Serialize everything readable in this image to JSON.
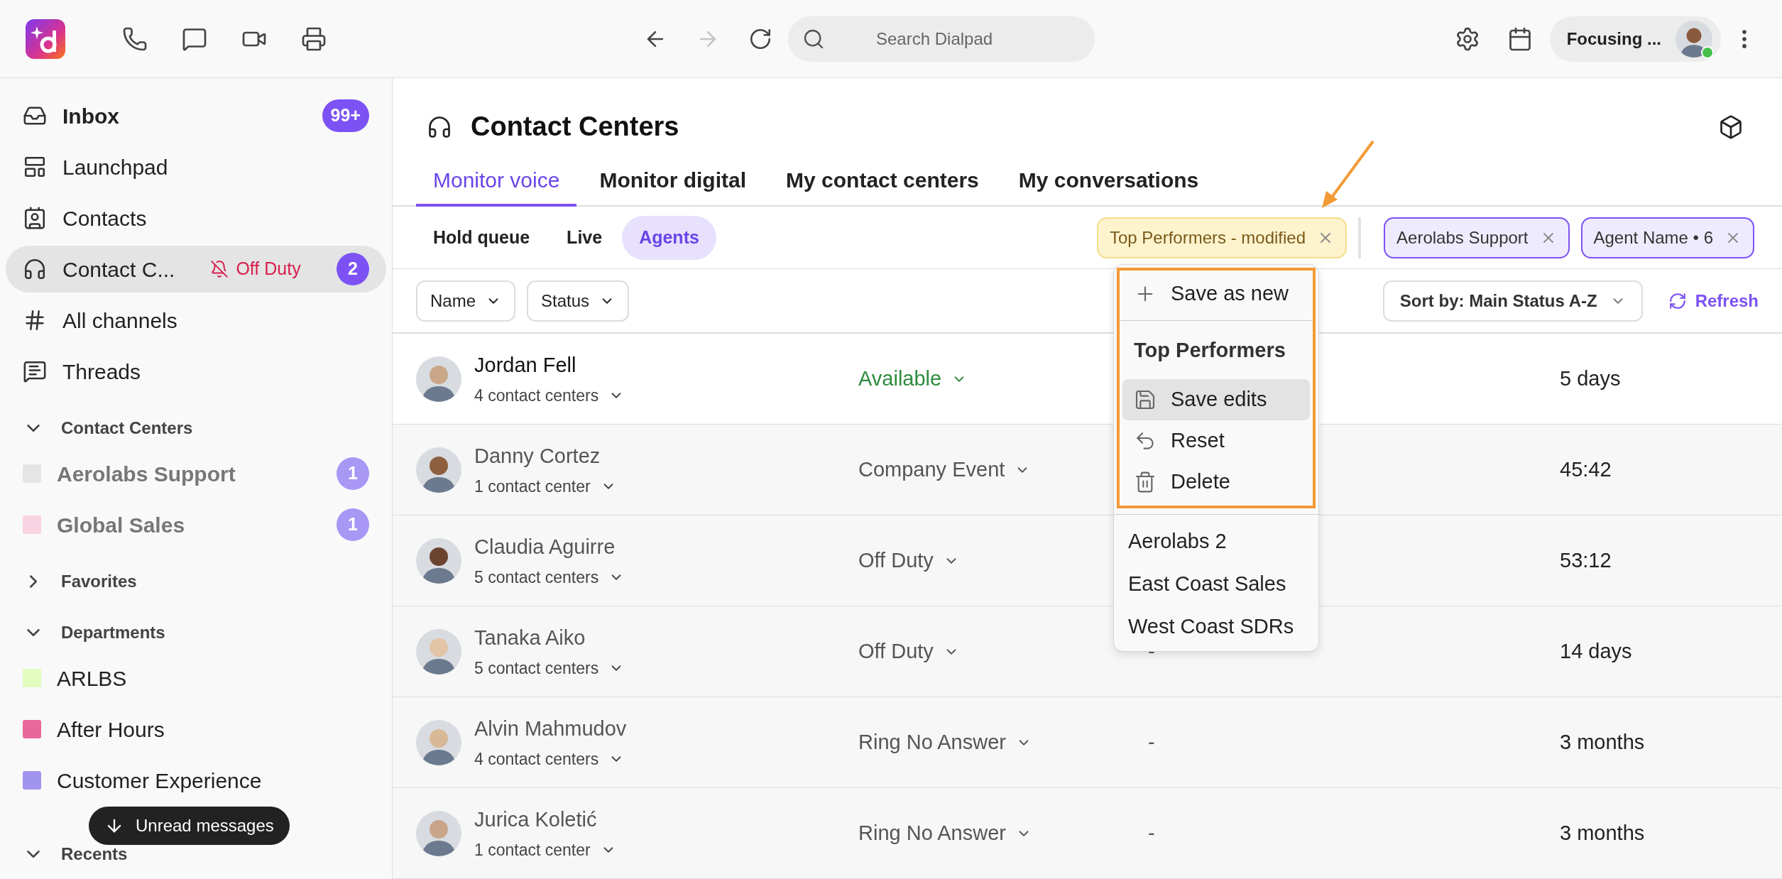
{
  "top_bar": {
    "tools": [
      {
        "kind": "phone"
      },
      {
        "kind": "chat"
      },
      {
        "kind": "video"
      },
      {
        "kind": "print"
      }
    ],
    "nav": [
      {
        "kind": "back",
        "disabled": false
      },
      {
        "kind": "forward",
        "disabled": true
      },
      {
        "kind": "reload",
        "disabled": false
      }
    ],
    "search": {
      "placeholder": "Search Dialpad"
    },
    "status": {
      "label": "Focusing ...",
      "online": true
    }
  },
  "sidebar": {
    "items": [
      {
        "kind": "inbox",
        "label": "Inbox",
        "bold": true,
        "badge": "99+",
        "selected": false
      },
      {
        "kind": "launchpad",
        "label": "Launchpad",
        "bold": false,
        "selected": false
      },
      {
        "kind": "contacts",
        "label": "Contacts",
        "bold": false,
        "selected": false
      },
      {
        "kind": "contact_center",
        "label": "Contact C...",
        "bold": false,
        "status": "Off Duty",
        "badge": "2",
        "selected": true
      },
      {
        "kind": "channels",
        "label": "All channels",
        "bold": false,
        "selected": false
      },
      {
        "kind": "threads",
        "label": "Threads",
        "bold": false,
        "selected": false
      }
    ],
    "sections": [
      {
        "title": "Contact Centers",
        "expanded": true,
        "items": [
          {
            "label": "Aerolabs Support",
            "color": "#e5e5e5",
            "unread": true,
            "badge": "1"
          },
          {
            "label": "Global Sales",
            "color": "#f8d3e2",
            "unread": true,
            "badge": "1"
          }
        ]
      },
      {
        "title": "Favorites",
        "expanded": false
      },
      {
        "title": "Departments",
        "expanded": true,
        "items": [
          {
            "label": "ARLBS",
            "color": "#e3fcc0",
            "unread": false
          },
          {
            "label": "After Hours",
            "color": "#e8689a",
            "unread": false
          },
          {
            "label": "Customer Experience",
            "color": "#a193f0",
            "unread": false
          }
        ]
      },
      {
        "title": "Recents",
        "expanded": true
      }
    ],
    "toast": "Unread messages"
  },
  "page": {
    "title": "Contact Centers",
    "tabs": [
      {
        "label": "Monitor voice",
        "selected": true
      },
      {
        "label": "Monitor digital",
        "selected": false
      },
      {
        "label": "My contact centers",
        "selected": false
      },
      {
        "label": "My conversations",
        "selected": false
      }
    ],
    "subtabs": [
      {
        "label": "Hold queue",
        "selected": false
      },
      {
        "label": "Live",
        "selected": false
      },
      {
        "label": "Agents",
        "selected": true
      }
    ],
    "chips": [
      {
        "label": "Top Performers - modified",
        "kind": "preset"
      },
      {
        "label": "Aerolabs Support",
        "kind": "filter"
      },
      {
        "label": "Agent Name • 6",
        "kind": "filter"
      }
    ],
    "filters": [
      {
        "label": "Name"
      },
      {
        "label": "Status"
      }
    ],
    "sort": "Sort by: Main Status A-Z",
    "refresh": "Refresh"
  },
  "agents": [
    {
      "name": "Jordan Fell",
      "centers": "4 contact centers",
      "active": true,
      "status": {
        "label": "Available",
        "color": "#2e8b3e"
      },
      "column_4": "5 days"
    },
    {
      "name": "Danny Cortez",
      "centers": "1 contact center",
      "active": false,
      "status": {
        "label": "Company Event",
        "color": "#555555"
      },
      "column_4": "45:42"
    },
    {
      "name": "Claudia Aguirre",
      "centers": "5 contact centers",
      "active": false,
      "status": {
        "label": "Off Duty",
        "color": "#555555"
      },
      "column_4": "53:12"
    },
    {
      "name": "Tanaka Aiko",
      "centers": "5 contact centers",
      "active": false,
      "status": {
        "label": "Off Duty",
        "color": "#555555"
      },
      "column_3": "-",
      "column_4": "14 days"
    },
    {
      "name": "Alvin Mahmudov",
      "centers": "4 contact centers",
      "active": false,
      "status": {
        "label": "Ring No Answer",
        "color": "#555555"
      },
      "column_3": "-",
      "column_4": "3 months"
    },
    {
      "name": "Jurica Koletić",
      "centers": "1 contact center",
      "active": false,
      "status": {
        "label": "Ring No Answer",
        "color": "#555555"
      },
      "column_3": "-",
      "column_4": "3 months"
    }
  ],
  "menu": {
    "highlight_frame": true,
    "items": [
      {
        "kind": "new",
        "label": "Save as new",
        "hovered": false
      },
      {
        "kind": "divider"
      },
      {
        "kind": "heading",
        "label": "Top Performers"
      },
      {
        "kind": "save",
        "label": "Save edits",
        "hovered": true
      },
      {
        "kind": "reset",
        "label": "Reset",
        "hovered": false
      },
      {
        "kind": "delete",
        "label": "Delete",
        "hovered": false
      },
      {
        "kind": "divider"
      },
      {
        "kind": "option",
        "label": "Aerolabs 2",
        "hovered": false
      },
      {
        "kind": "option",
        "label": "East Coast Sales",
        "hovered": false
      },
      {
        "kind": "option",
        "label": "West Coast SDRs",
        "hovered": false
      }
    ]
  },
  "annotation_arrow": true
}
